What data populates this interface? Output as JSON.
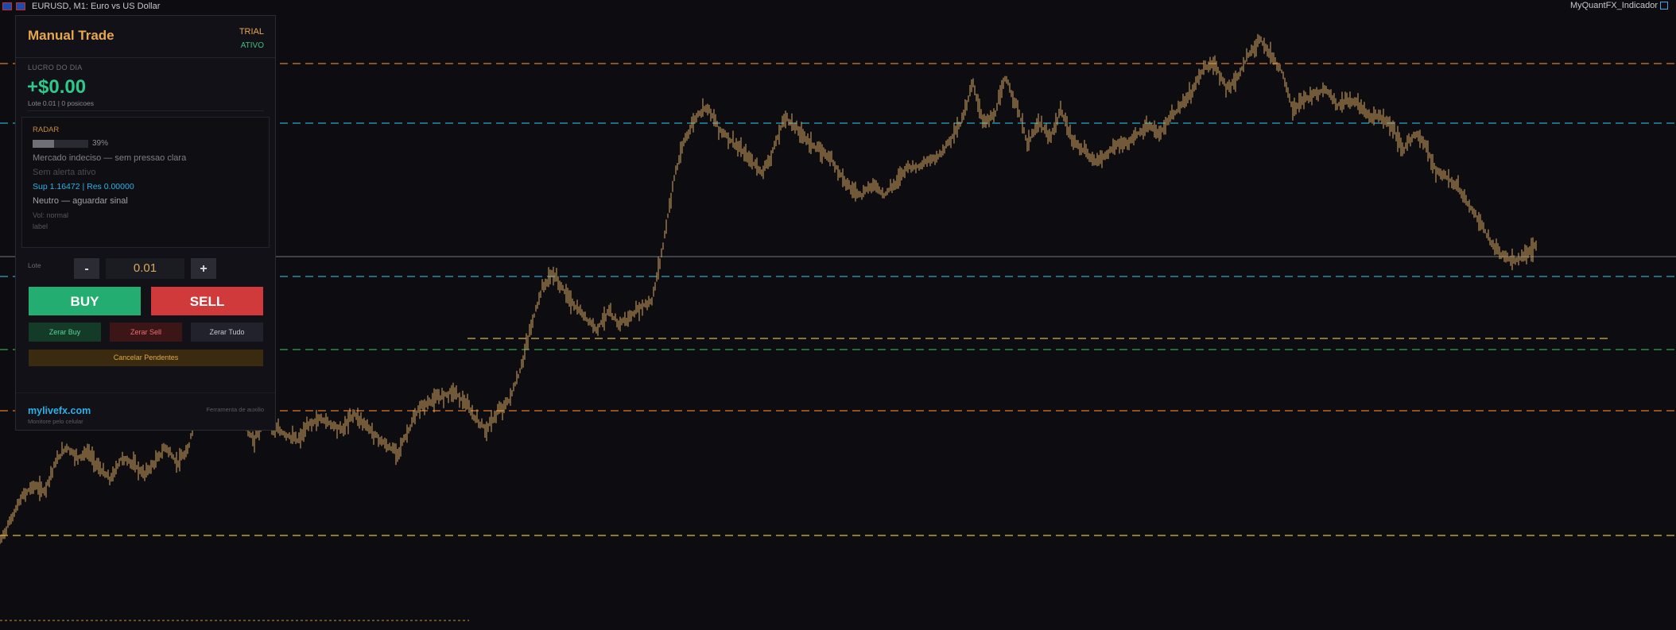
{
  "window": {
    "title": "EURUSD, M1:  Euro vs US Dollar",
    "indicator_label": "MyQuantFX_Indicador"
  },
  "panel": {
    "title": "Manual Trade",
    "license_badge": "TRIAL",
    "status_badge": "ATIVO",
    "profit": {
      "label": "LUCRO DO DIA",
      "value": "+$0.00",
      "sub": "Lote 0.01  |  0 posicoes"
    },
    "radar": {
      "label": "RADAR",
      "strength_pct": 39,
      "strength_text": "39%",
      "market_state": "Mercado indeciso — sem pressao clara",
      "alert_state": "Sem alerta ativo",
      "levels": "Sup 1.16472 | Res 0.00000",
      "signal": "Neutro — aguardar sinal",
      "volume": "Vol: normal",
      "extra": "label"
    },
    "lot": {
      "label": "Lote",
      "minus_label": "-",
      "plus_label": "+",
      "value": "0.01"
    },
    "buy_label": "BUY",
    "sell_label": "SELL",
    "close_buy_label": "Zerar Buy",
    "close_sell_label": "Zerar Sell",
    "close_all_label": "Zerar Tudo",
    "cancel_pending_label": "Cancelar Pendentes",
    "footer": {
      "site": "mylivefx.com",
      "sub": "Monitore pelo celular",
      "right": "Ferramenta de auxilio"
    }
  },
  "chart_data": {
    "type": "line",
    "symbol": "EURUSD",
    "timeframe": "M1",
    "series": [
      {
        "values": [
          0.1,
          0.14,
          0.18,
          0.2,
          0.19,
          0.24,
          0.27,
          0.25,
          0.26,
          0.23,
          0.21,
          0.25,
          0.24,
          0.22,
          0.24,
          0.27,
          0.24,
          0.26,
          0.37,
          0.39,
          0.36,
          0.34,
          0.31,
          0.28,
          0.32,
          0.3,
          0.29,
          0.28,
          0.31,
          0.32,
          0.31,
          0.3,
          0.33,
          0.31,
          0.29,
          0.27,
          0.26,
          0.3,
          0.34,
          0.35,
          0.36,
          0.37,
          0.35,
          0.32,
          0.3,
          0.33,
          0.35,
          0.4,
          0.48,
          0.55,
          0.58,
          0.55,
          0.52,
          0.5,
          0.48,
          0.51,
          0.49,
          0.5,
          0.52,
          0.53,
          0.63,
          0.75,
          0.82,
          0.86,
          0.88,
          0.84,
          0.82,
          0.8,
          0.78,
          0.76,
          0.8,
          0.86,
          0.84,
          0.82,
          0.8,
          0.79,
          0.76,
          0.73,
          0.72,
          0.74,
          0.72,
          0.74,
          0.77,
          0.77,
          0.78,
          0.79,
          0.82,
          0.85,
          0.92,
          0.85,
          0.86,
          0.93,
          0.88,
          0.81,
          0.85,
          0.82,
          0.87,
          0.82,
          0.8,
          0.78,
          0.79,
          0.81,
          0.81,
          0.83,
          0.84,
          0.83,
          0.86,
          0.88,
          0.91,
          0.95,
          0.95,
          0.91,
          0.93,
          0.97,
          1.0,
          0.97,
          0.94,
          0.87,
          0.89,
          0.9,
          0.91,
          0.88,
          0.89,
          0.88,
          0.86,
          0.86,
          0.84,
          0.8,
          0.83,
          0.81,
          0.76,
          0.75,
          0.73,
          0.7,
          0.67,
          0.63,
          0.61,
          0.6,
          0.61,
          0.63
        ]
      }
    ],
    "horizontal_levels": [
      {
        "style": "dashed",
        "color": "#d9782e"
      },
      {
        "style": "dashed",
        "color": "#2ea6c9"
      },
      {
        "style": "solid",
        "color": "#9aa3ad"
      },
      {
        "style": "dashed",
        "color": "#2ea6c9"
      },
      {
        "style": "dashed",
        "color": "#d9b24a"
      },
      {
        "style": "dashed",
        "color": "#2ea84a"
      },
      {
        "style": "dashed",
        "color": "#d9782e"
      },
      {
        "style": "dashed",
        "color": "#e0c020"
      },
      {
        "style": "dotted",
        "color": "#a07830"
      }
    ],
    "candle_color": "#d8a860",
    "grid": false
  },
  "colors": {
    "background": "#0c0c11",
    "accent_orange": "#e6a74e",
    "profit_green": "#2ec98a",
    "buy_green": "#24ad70",
    "sell_red": "#d03a3a",
    "link_blue": "#2cb0e8"
  }
}
